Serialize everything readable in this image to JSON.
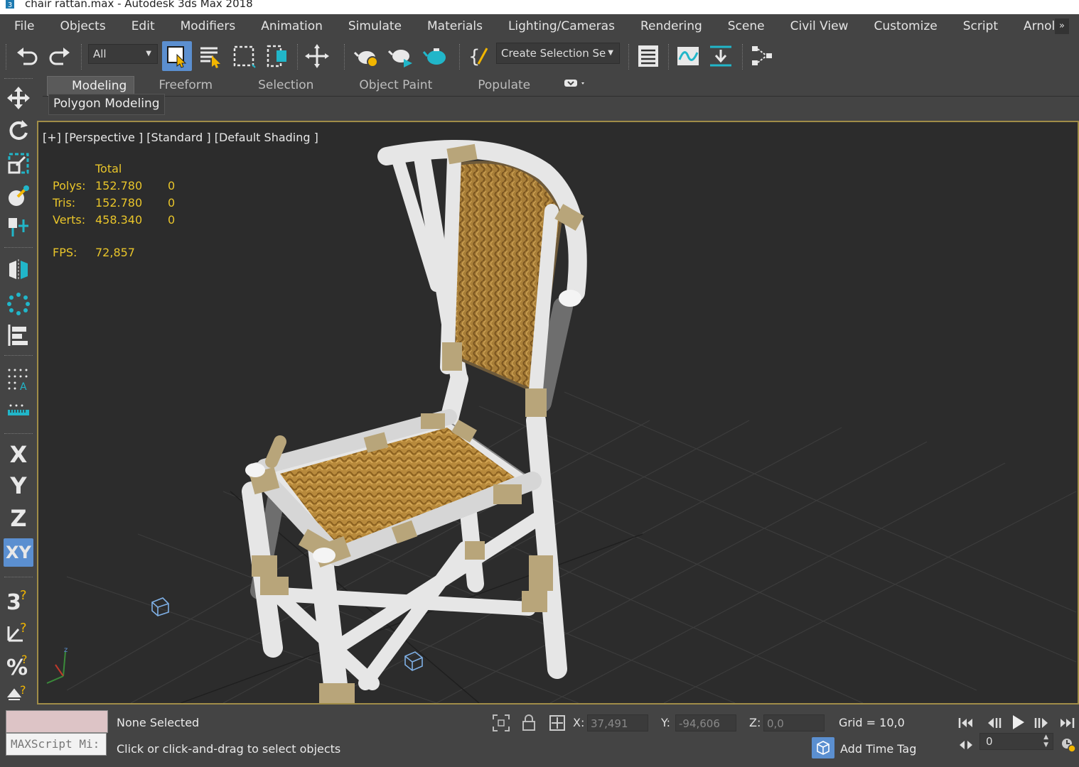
{
  "window": {
    "title": "chair rattan.max - Autodesk 3ds Max 2018"
  },
  "menu": [
    "File",
    "Objects",
    "Edit",
    "Modifiers",
    "Animation",
    "Simulate",
    "Materials",
    "Lighting/Cameras",
    "Rendering",
    "Scene",
    "Civil View",
    "Customize",
    "Script",
    "Arnold"
  ],
  "menu_more": "»",
  "toolbar": {
    "filter": "All",
    "selection_set": "Create Selection Se"
  },
  "ribbon": {
    "tabs": [
      "Modeling",
      "Freeform",
      "Selection",
      "Object Paint",
      "Populate"
    ],
    "active_tab": "Modeling",
    "panel": "Polygon Modeling"
  },
  "left_toolbar": {
    "axes": [
      "X",
      "Y",
      "Z",
      "XY"
    ]
  },
  "viewport": {
    "label": "[+] [Perspective ] [Standard ] [Default Shading ]",
    "stats": {
      "header": "Total",
      "rows": [
        {
          "label": "Polys:",
          "total": "152.780",
          "sel": "0"
        },
        {
          "label": "Tris:",
          "total": "152.780",
          "sel": "0"
        },
        {
          "label": "Verts:",
          "total": "458.340",
          "sel": "0"
        }
      ],
      "fps_label": "FPS:",
      "fps": "72,857"
    }
  },
  "status": {
    "maxscript": "MAXScript Mi:",
    "selected": "None Selected",
    "prompt": "Click or click-and-drag to select objects",
    "x_label": "X:",
    "x": "37,491",
    "y_label": "Y:",
    "y": "-94,606",
    "z_label": "Z:",
    "z": "0,0",
    "grid": "Grid = 10,0",
    "time_tag": "Add Time Tag",
    "frame": "0"
  },
  "colors": {
    "accent": "#5b8fd0",
    "viewport_border": "#a08d48",
    "stats": "#e9c52a",
    "teal": "#21b6c9"
  }
}
